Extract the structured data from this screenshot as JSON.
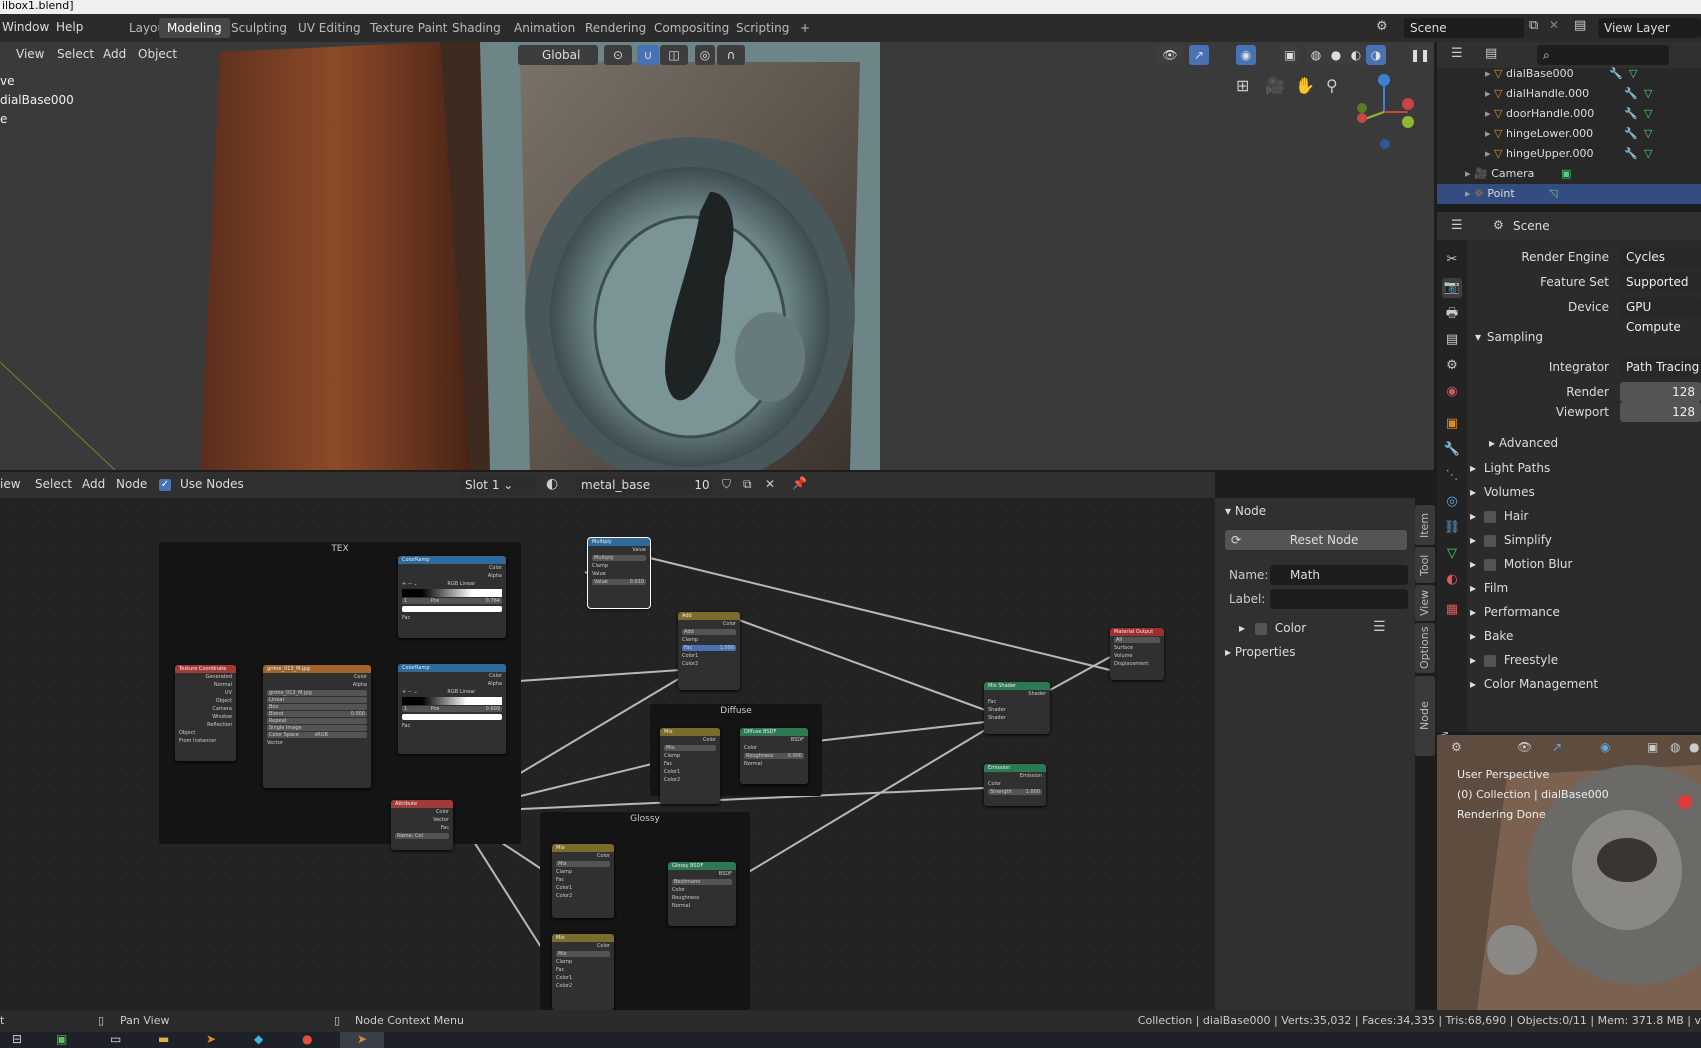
{
  "window_title": "ilbox1.blend]",
  "menu": {
    "window": "Window",
    "help": "Help"
  },
  "workspaces": [
    "Layout",
    "Modeling",
    "Sculpting",
    "UV Editing",
    "Texture Paint",
    "Shading",
    "Animation",
    "Rendering",
    "Compositing",
    "Scripting",
    "+"
  ],
  "scene_field": "Scene",
  "view_layer_field": "View Layer",
  "viewport": {
    "menus": [
      "View",
      "Select",
      "Add",
      "Object"
    ],
    "transform_orientation": "Global",
    "info_lines": [
      "ve",
      "dialBase000",
      "e"
    ]
  },
  "outliner": {
    "items": [
      {
        "label": "dialBase000"
      },
      {
        "label": "dialHandle.000"
      },
      {
        "label": "doorHandle.000"
      },
      {
        "label": "hingeLower.000"
      },
      {
        "label": "hingeUpper.000"
      },
      {
        "label": "Camera"
      },
      {
        "label": "Point"
      }
    ]
  },
  "properties": {
    "context": "Scene",
    "render_engine_label": "Render Engine",
    "render_engine": "Cycles",
    "feature_set_label": "Feature Set",
    "feature_set": "Supported",
    "device_label": "Device",
    "device": "GPU Compute",
    "sampling": "Sampling",
    "integrator_label": "Integrator",
    "integrator": "Path Tracing",
    "render_label": "Render",
    "render_samples": "128",
    "viewport_label": "Viewport",
    "viewport_samples": "128",
    "advanced": "Advanced",
    "sections": [
      "Light Paths",
      "Volumes",
      "Hair",
      "Simplify",
      "Motion Blur",
      "Film",
      "Performance",
      "Bake",
      "Freestyle",
      "Color Management"
    ]
  },
  "node_editor": {
    "menus": [
      "iew",
      "Select",
      "Add",
      "Node"
    ],
    "use_nodes": "Use Nodes",
    "slot": "Slot 1",
    "material": "metal_base",
    "users": "10",
    "frames": {
      "tex": "TEX",
      "diffuse": "Diffuse",
      "glossy": "Glossy"
    },
    "nodes": {
      "texcoord": {
        "title": "Texture Coordinate",
        "outs": [
          "Generated",
          "Normal",
          "UV",
          "Object",
          "Camera",
          "Window",
          "Reflection"
        ],
        "object": "Object",
        "from_instancer": "From Instancer"
      },
      "image": {
        "title": "grime_013_M.jpg",
        "outs": [
          "Color",
          "Alpha"
        ],
        "file": "grime_013_M.jpg",
        "opts": [
          "Linear",
          "Box",
          "Repeat",
          "Single Image"
        ],
        "blend_label": "Blend",
        "blend": "0.000",
        "colorspace_label": "Color Space",
        "colorspace": "sRGB",
        "vector": "Vector"
      },
      "ramp1": {
        "title": "ColorRamp",
        "outs": [
          "Color",
          "Alpha"
        ],
        "mode": "RGB",
        "interp": "Linear",
        "pos_label": "Pos",
        "pos": "0.764",
        "idx": "1",
        "fac": "Fac"
      },
      "ramp2": {
        "title": "ColorRamp",
        "outs": [
          "Color",
          "Alpha"
        ],
        "mode": "RGB",
        "interp": "Linear",
        "pos_label": "Pos",
        "pos": "0.609",
        "idx": "1",
        "fac": "Fac"
      },
      "multiply": {
        "title": "Multiply",
        "out": "Value",
        "op": "Multiply",
        "clamp": "Clamp",
        "value_label": "Value",
        "value": "0.010",
        "val2": "Value"
      },
      "add": {
        "title": "Add",
        "out": "Color",
        "op": "Add",
        "clamp": "Clamp",
        "fac_label": "Fac",
        "fac": "1.000",
        "c1": "Color1",
        "c2": "Color2"
      },
      "mixshader": {
        "title": "Mix Shader",
        "out": "Shader",
        "ins": [
          "Fac",
          "Shader",
          "Shader"
        ]
      },
      "output": {
        "title": "Material Output",
        "target": "All",
        "ins": [
          "Surface",
          "Volume",
          "Displacement"
        ]
      },
      "mixd": {
        "title": "Mix",
        "out": "Color",
        "op": "Mix",
        "clamp": "Clamp",
        "ins": [
          "Fac",
          "Color1",
          "Color2"
        ]
      },
      "diffuse": {
        "title": "Diffuse BSDF",
        "out": "BSDF",
        "ins": [
          "Color"
        ],
        "rough_label": "Roughness",
        "rough": "0.000",
        "normal": "Normal"
      },
      "emission": {
        "title": "Emission",
        "out": "Emission",
        "color": "Color",
        "strength_label": "Strength",
        "strength": "1.000"
      },
      "attribute": {
        "title": "Attribute",
        "outs": [
          "Color",
          "Vector",
          "Fac"
        ],
        "name_label": "Name:",
        "name": "Col"
      },
      "mixg1": {
        "title": "Mix",
        "out": "Color",
        "op": "Mix",
        "clamp": "Clamp",
        "ins": [
          "Fac",
          "Color1",
          "Color2"
        ]
      },
      "mixg2": {
        "title": "Mix",
        "out": "Color",
        "op": "Mix",
        "clamp": "Clamp",
        "ins": [
          "Fac",
          "Color1",
          "Color2"
        ]
      },
      "glossy": {
        "title": "Glossy BSDF",
        "out": "BSDF",
        "dist": "Beckmann",
        "ins": [
          "Color",
          "Roughness",
          "Normal"
        ]
      }
    }
  },
  "npanel": {
    "section": "Node",
    "reset": "Reset Node",
    "name_label": "Name:",
    "name": "Math",
    "label_label": "Label:",
    "label": "",
    "color": "Color",
    "properties": "Properties",
    "tabs": [
      "Item",
      "Tool",
      "View",
      "Options",
      "Node Wrangler"
    ]
  },
  "render_view": {
    "lines": [
      "User Perspective",
      "(0) Collection | dialBase000",
      "Rendering Done"
    ]
  },
  "status": {
    "left": "t",
    "pan": "Pan View",
    "context_menu": "Node Context Menu",
    "stats": "Collection | dialBase000 | Verts:35,032 | Faces:34,335 | Tris:68,690 | Objects:0/11 | Mem: 371.8 MB | v"
  },
  "colors": {
    "accent": "#4772b3",
    "orange": "#e08a2c",
    "selected_row": "#334d80"
  }
}
